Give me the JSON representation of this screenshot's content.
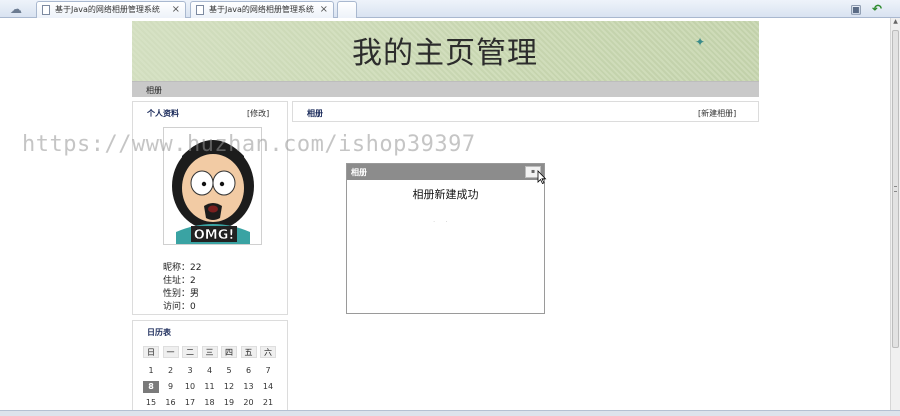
{
  "browser": {
    "tabs": [
      {
        "label": "基于Java的网络相册管理系统"
      },
      {
        "label": "基于Java的网络相册管理系统"
      }
    ]
  },
  "header": {
    "title": "我的主页管理"
  },
  "breadcrumb": {
    "label": "相册"
  },
  "profile": {
    "title": "个人资料",
    "edit_link": "[修改]",
    "avatar_caption": "OMG!",
    "nickname_label": "昵称：",
    "nickname": "22",
    "address_label": "住址：",
    "address": "2",
    "gender_label": "性别：",
    "gender": "男",
    "visits_label": "访问：",
    "visits": "0"
  },
  "calendar": {
    "title": "日历表",
    "weekdays": [
      "日",
      "一",
      "二",
      "三",
      "四",
      "五",
      "六"
    ],
    "rows": [
      [
        "1",
        "2",
        "3",
        "4",
        "5",
        "6",
        "7"
      ],
      [
        "8",
        "9",
        "10",
        "11",
        "12",
        "13",
        "14"
      ],
      [
        "15",
        "16",
        "17",
        "18",
        "19",
        "20",
        "21"
      ]
    ],
    "today": "8"
  },
  "album": {
    "title": "相册",
    "new_album_link": "[新建相册]"
  },
  "dialog": {
    "title": "相册",
    "message": "相册新建成功"
  },
  "watermark": "https://www.huzhan.com/ishop39397"
}
